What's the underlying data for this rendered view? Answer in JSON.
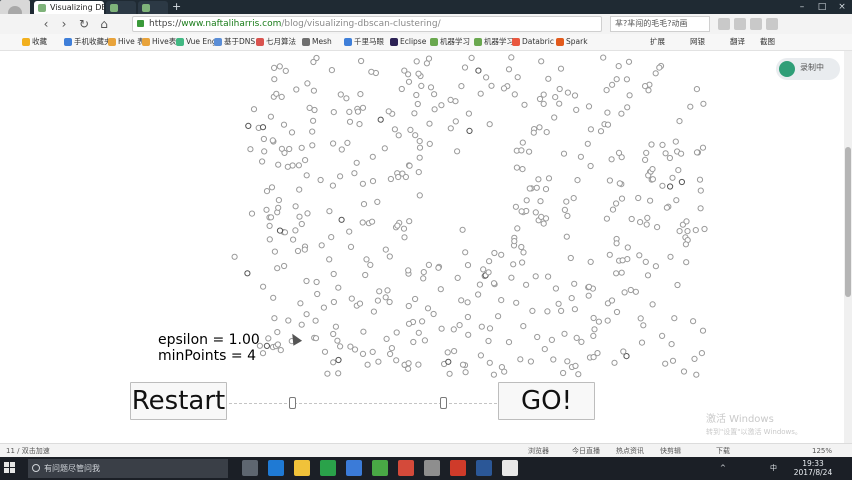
{
  "browser": {
    "tabs": [
      {
        "label": "Visualizing DBSCAN Clustering",
        "active": true
      },
      {
        "label": "",
        "active": false
      },
      {
        "label": "",
        "active": false
      }
    ],
    "new_tab": "+",
    "nav": {
      "back": "‹",
      "forward": "›",
      "reload": "↻",
      "home": "⌂"
    },
    "url": {
      "scheme": "https://",
      "host": "www.naftaliharris.com",
      "path": "/blog/visualizing-dbscan-clustering/"
    },
    "search_text": "芈?芈闯的毛毛?动画",
    "window": {
      "min": "–",
      "max": "□",
      "close": "×"
    }
  },
  "bookmarks": [
    {
      "label": "收藏",
      "color": "#f2b01e"
    },
    {
      "label": "手机收藏夹",
      "color": "#3f7fd9"
    },
    {
      "label": "Hive 表",
      "color": "#e8a33b"
    },
    {
      "label": "Hive表",
      "color": "#e8a33b"
    },
    {
      "label": "Vue Eng",
      "color": "#42b883"
    },
    {
      "label": "基于DNS",
      "color": "#5a8dd6"
    },
    {
      "label": "七月算法",
      "color": "#d9534f"
    },
    {
      "label": "Mesh",
      "color": "#6f6f6f"
    },
    {
      "label": "千里马眼",
      "color": "#3f7fd9"
    },
    {
      "label": "Eclipse",
      "color": "#2c2255"
    },
    {
      "label": "机器学习",
      "color": "#6aa84f"
    },
    {
      "label": "机器学习",
      "color": "#6aa84f"
    },
    {
      "label": "Databric",
      "color": "#e9573f"
    },
    {
      "label": "Spark",
      "color": "#e25a1c"
    }
  ],
  "bookmarks_right": [
    {
      "label": "扩展"
    },
    {
      "label": "网银"
    },
    {
      "label": "翻译"
    },
    {
      "label": "截图"
    }
  ],
  "recorder": {
    "label": "录制中"
  },
  "dbscan": {
    "epsilon_text": "epsilon = 1.00",
    "minpoints_text": "minPoints = 4",
    "restart_label": "Restart",
    "go_label": "GO!",
    "point_color": "#9a9a9a",
    "dark_point_color": "#555555"
  },
  "watermark": {
    "title": "激活 Windows",
    "subtitle": "转到\"设置\"以激活 Windows。"
  },
  "statusbar": {
    "left": "11 / 双击加速",
    "items": [
      "浏览器",
      "今日直播",
      "热点资讯",
      "快剪辑",
      "下载",
      "125%"
    ]
  },
  "taskbar": {
    "search_placeholder": "有问题尽管问我",
    "tray": [
      "^",
      "中"
    ],
    "time": "19:33",
    "date": "2017/8/24"
  },
  "accent_colors": {
    "taskbar": "#1b1f26",
    "url_host": "#1a7d1a"
  }
}
